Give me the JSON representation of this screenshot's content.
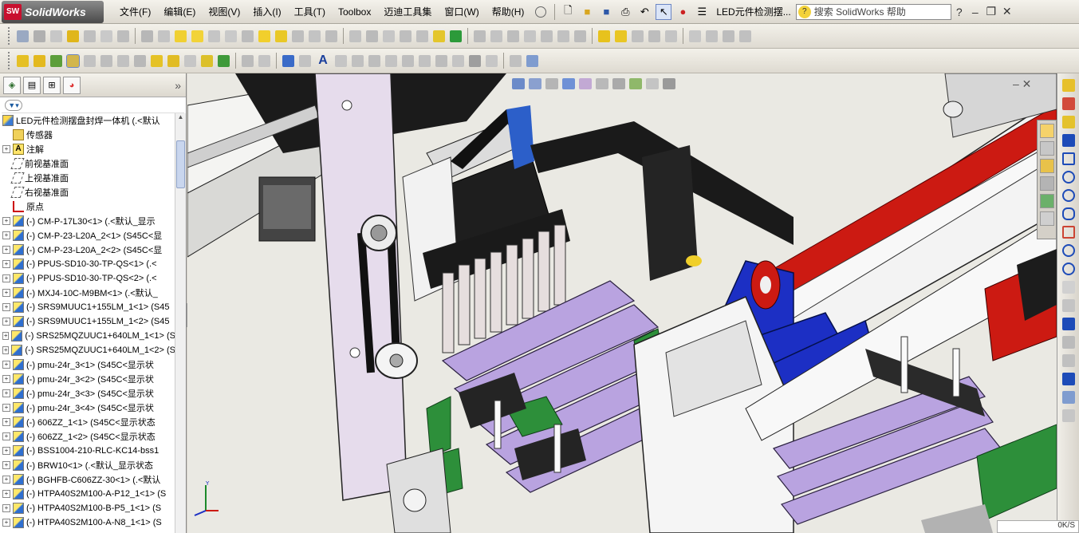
{
  "app": {
    "logo_text": "SolidWorks",
    "badge": "SW"
  },
  "menu": [
    "文件(F)",
    "编辑(E)",
    "视图(V)",
    "插入(I)",
    "工具(T)",
    "Toolbox",
    "迈迪工具集",
    "窗口(W)",
    "帮助(H)"
  ],
  "document_title": "LED元件检测摆...",
  "search": {
    "placeholder": "搜索 SolidWorks 帮助"
  },
  "tree": {
    "root": "LED元件检测摆盘封焊一体机  (.<默认",
    "features": [
      {
        "label": "传感器",
        "icon": "sensor-icon",
        "expandable": false
      },
      {
        "label": "注解",
        "icon": "annotation-icon",
        "expandable": true
      },
      {
        "label": "前视基准面",
        "icon": "plane-icon",
        "expandable": false
      },
      {
        "label": "上视基准面",
        "icon": "plane-icon",
        "expandable": false
      },
      {
        "label": "右视基准面",
        "icon": "plane-icon",
        "expandable": false
      },
      {
        "label": "原点",
        "icon": "origin-icon",
        "expandable": false
      }
    ],
    "components": [
      "(-) CM-P-17L30<1> (.<默认_显示",
      "(-) CM-P-23-L20A_2<1> (S45C<显",
      "(-) CM-P-23-L20A_2<2> (S45C<显",
      "(-) PPUS-SD10-30-TP-QS<1> (.<",
      "(-) PPUS-SD10-30-TP-QS<2> (.<",
      "(-) MXJ4-10C-M9BM<1> (.<默认_",
      "(-) SRS9MUUC1+155LM_1<1> (S45",
      "(-) SRS9MUUC1+155LM_1<2> (S45",
      "(-) SRS25MQZUUC1+640LM_1<1> (S",
      "(-) SRS25MQZUUC1+640LM_1<2> (S",
      "(-) pmu-24r_3<1> (S45C<显示状",
      "(-) pmu-24r_3<2> (S45C<显示状",
      "(-) pmu-24r_3<3> (S45C<显示状",
      "(-) pmu-24r_3<4> (S45C<显示状",
      "(-) 606ZZ_1<1> (S45C<显示状态",
      "(-) 606ZZ_1<2> (S45C<显示状态",
      "(-) BSS1004-210-RLC-KC14-bss1",
      "(-) BRW10<1> (.<默认_显示状态",
      "(-) BGHFB-C606ZZ-30<1> (.<默认",
      "(-) HTPA40S2M100-A-P12_1<1> (S",
      "(-) HTPA40S2M100-B-P5_1<1> (S",
      "(-) HTPA40S2M100-A-N8_1<1> (S"
    ]
  },
  "status_text": "0K/S",
  "colors": {
    "belt": "#cc1a12",
    "bracket": "#1c2fc4",
    "rollers": "#b9a3e0",
    "plate": "#e6dcec",
    "rail": "#2d8f3a"
  }
}
